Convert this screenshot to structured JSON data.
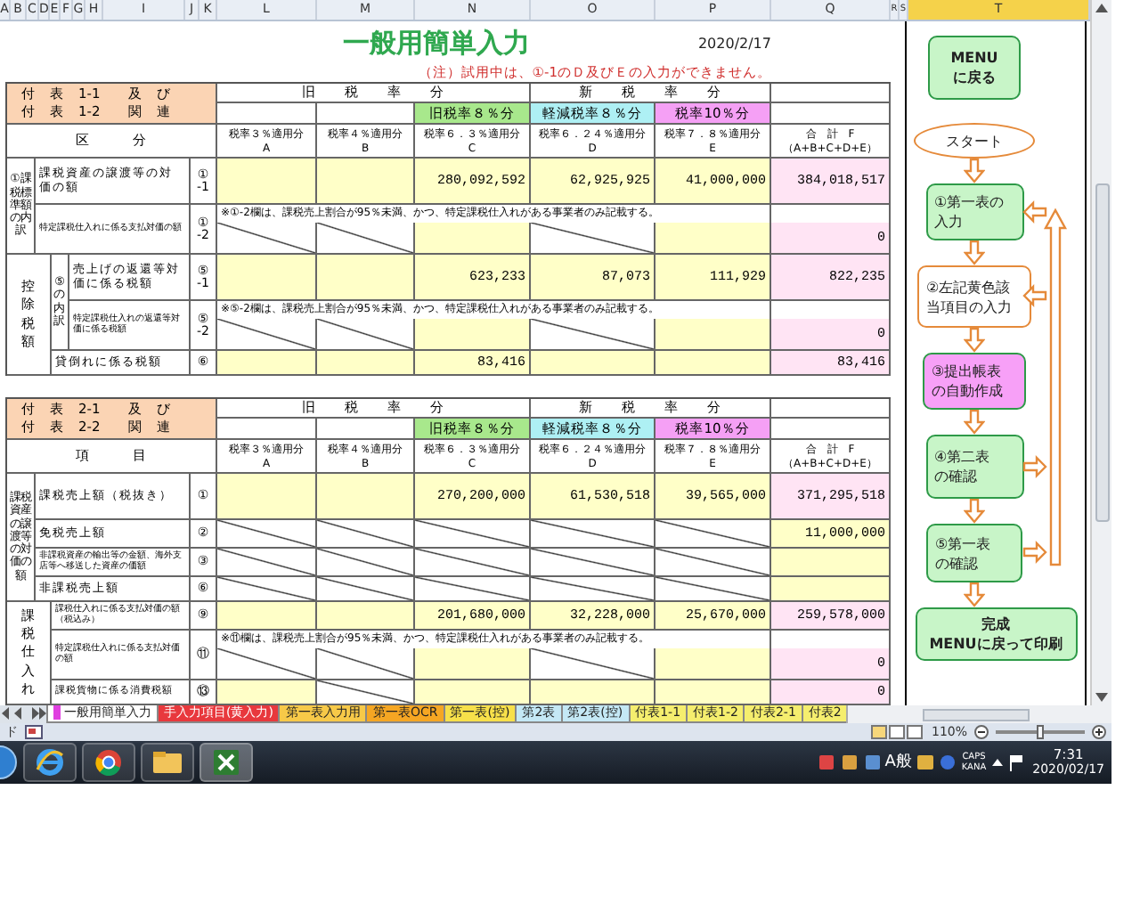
{
  "column_letters": [
    {
      "label": "A",
      "selected": false
    },
    {
      "label": "B",
      "selected": false
    },
    {
      "label": "C",
      "selected": false
    },
    {
      "label": "D",
      "selected": false
    },
    {
      "label": "E",
      "selected": false
    },
    {
      "label": "F",
      "selected": false
    },
    {
      "label": "G",
      "selected": false
    },
    {
      "label": "H",
      "selected": false
    },
    {
      "label": "I",
      "selected": false
    },
    {
      "label": "J",
      "selected": false
    },
    {
      "label": "K",
      "selected": false
    },
    {
      "label": "L",
      "selected": false
    },
    {
      "label": "M",
      "selected": false
    },
    {
      "label": "N",
      "selected": false
    },
    {
      "label": "O",
      "selected": false
    },
    {
      "label": "P",
      "selected": false
    },
    {
      "label": "Q",
      "selected": false
    },
    {
      "label": "R",
      "selected": false
    },
    {
      "label": "S",
      "selected": false
    },
    {
      "label": "T",
      "selected": true
    }
  ],
  "title": "一般用簡単入力",
  "date": "2020/2/17",
  "notice": "（注）試用中は、①-1のＤ及びＥの入力ができません。",
  "tables": [
    {
      "heading_lines": [
        "付　表　1-1　　及　び",
        "付　表　1-2　　関　連"
      ],
      "row_head": "区　　　分",
      "old_rate": "旧　　税　　率　　分",
      "new_rate": "新　　税　　率　　分",
      "rate_tags": [
        {
          "label": "旧税率８％分",
          "color": "#a8e88c"
        },
        {
          "label": "軽減税率８％分",
          "color": "#aef0f4"
        },
        {
          "label": "税率10％分",
          "color": "#f5a0f5"
        }
      ],
      "column_heads": [
        {
          "label": "税率３％適用分",
          "letter": "A"
        },
        {
          "label": "税率４％適用分",
          "letter": "B"
        },
        {
          "label": "税率６．３％適用分",
          "letter": "C"
        },
        {
          "label": "税率６．２４％適用分",
          "letter": "D"
        },
        {
          "label": "税率７．８％適用分",
          "letter": "E"
        }
      ],
      "total_head": {
        "label": "合　計　F",
        "formula": "（A+B+C+D+E）"
      },
      "groups": [
        {
          "label": "①課税標準額の内訳",
          "kind": "double",
          "parts": [
            {
              "rows": [
                {
                  "no": "①-1",
                  "label": "課税資産の譲渡等の対価の額",
                  "kind": "tall",
                  "cells": [
                    {
                      "kind": "input"
                    },
                    {
                      "kind": "input"
                    },
                    {
                      "kind": "input",
                      "value": "280,092,592"
                    },
                    {
                      "kind": "input",
                      "value": "62,925,925"
                    },
                    {
                      "kind": "input",
                      "value": "41,000,000"
                    },
                    {
                      "kind": "total",
                      "value": "384,018,517"
                    }
                  ]
                },
                {
                  "no": "①-2",
                  "label": "特定課税仕入れに係る支払対価の額",
                  "kind": "note",
                  "note": "※①-2欄は、課税売上割合が95％未満、かつ、特定課税仕入れがある事業者のみ記載する。",
                  "cells": [
                    {
                      "kind": "struck"
                    },
                    {
                      "kind": "struck"
                    },
                    {
                      "kind": "input"
                    },
                    {
                      "kind": "struck"
                    },
                    {
                      "kind": "input"
                    },
                    {
                      "kind": "total",
                      "value": "0"
                    }
                  ]
                }
              ]
            }
          ]
        },
        {
          "label": "控除税額",
          "kind": "single",
          "parts": [
            {
              "label": "⑤の内訳",
              "rows": [
                {
                  "no": "⑤-1",
                  "label": "売上げの返還等対価に係る税額",
                  "kind": "tall",
                  "cells": [
                    {
                      "kind": "input"
                    },
                    {
                      "kind": "input"
                    },
                    {
                      "kind": "input",
                      "value": "623,233"
                    },
                    {
                      "kind": "input",
                      "value": "87,073"
                    },
                    {
                      "kind": "input",
                      "value": "111,929"
                    },
                    {
                      "kind": "total",
                      "value": "822,235"
                    }
                  ]
                },
                {
                  "no": "⑤-2",
                  "label": "特定課税仕入れの返還等対価に係る税額",
                  "kind": "note",
                  "note": "※⑤-2欄は、課税売上割合が95％未満、かつ、特定課税仕入れがある事業者のみ記載する。",
                  "cells": [
                    {
                      "kind": "struck"
                    },
                    {
                      "kind": "struck"
                    },
                    {
                      "kind": "input"
                    },
                    {
                      "kind": "struck"
                    },
                    {
                      "kind": "input"
                    },
                    {
                      "kind": "total",
                      "value": "0"
                    }
                  ]
                }
              ]
            },
            {
              "rows": [
                {
                  "no": "⑥",
                  "label": "貸倒れに係る税額",
                  "kind": "short",
                  "cells": [
                    {
                      "kind": "input"
                    },
                    {
                      "kind": "input"
                    },
                    {
                      "kind": "input",
                      "value": "83,416"
                    },
                    {
                      "kind": "input"
                    },
                    {
                      "kind": "input"
                    },
                    {
                      "kind": "total",
                      "value": "83,416"
                    }
                  ]
                }
              ]
            }
          ]
        }
      ]
    },
    {
      "heading_lines": [
        "付　表　2-1　　及　び",
        "付　表　2-2　　関　連"
      ],
      "row_head": "項　　　目",
      "old_rate": "旧　　税　　率　　分",
      "new_rate": "新　　税　　率　　分",
      "rate_tags": [
        {
          "label": "旧税率８％分",
          "color": "#a8e88c"
        },
        {
          "label": "軽減税率８％分",
          "color": "#aef0f4"
        },
        {
          "label": "税率10％分",
          "color": "#f5a0f5"
        }
      ],
      "column_heads": [
        {
          "label": "税率３％適用分",
          "letter": "A"
        },
        {
          "label": "税率４％適用分",
          "letter": "B"
        },
        {
          "label": "税率６．３％適用分",
          "letter": "C"
        },
        {
          "label": "税率６．２４％適用分",
          "letter": "D"
        },
        {
          "label": "税率７．８％適用分",
          "letter": "E"
        }
      ],
      "total_head": {
        "label": "合　計　F",
        "formula": "（A+B+C+D+E）"
      },
      "groups": [
        {
          "label": "課税資産の譲渡等の対価の額",
          "kind": "double",
          "parts": [
            {
              "rows": [
                {
                  "no": "①",
                  "label": "課税売上額（税抜き）",
                  "kind": "tall",
                  "cells": [
                    {
                      "kind": "input"
                    },
                    {
                      "kind": "input"
                    },
                    {
                      "kind": "input",
                      "value": "270,200,000"
                    },
                    {
                      "kind": "input",
                      "value": "61,530,518"
                    },
                    {
                      "kind": "input",
                      "value": "39,565,000"
                    },
                    {
                      "kind": "total",
                      "value": "371,295,518"
                    }
                  ]
                },
                {
                  "no": "②",
                  "label": "免税売上額",
                  "kind": "medium",
                  "cells": [
                    {
                      "kind": "struck"
                    },
                    {
                      "kind": "struck"
                    },
                    {
                      "kind": "struck"
                    },
                    {
                      "kind": "struck"
                    },
                    {
                      "kind": "struck"
                    },
                    {
                      "kind": "input",
                      "value": "11,000,000"
                    }
                  ]
                },
                {
                  "no": "③",
                  "label": "非課税資産の輸出等の金額、海外支店等へ移送した資産の価額",
                  "kind": "medium",
                  "cells": [
                    {
                      "kind": "struck"
                    },
                    {
                      "kind": "struck"
                    },
                    {
                      "kind": "struck"
                    },
                    {
                      "kind": "struck"
                    },
                    {
                      "kind": "struck"
                    },
                    {
                      "kind": "input"
                    }
                  ]
                },
                {
                  "no": "⑥",
                  "label": "非課税売上額",
                  "kind": "short",
                  "cells": [
                    {
                      "kind": "struck"
                    },
                    {
                      "kind": "struck"
                    },
                    {
                      "kind": "struck"
                    },
                    {
                      "kind": "struck"
                    },
                    {
                      "kind": "struck"
                    },
                    {
                      "kind": "input"
                    }
                  ]
                }
              ]
            }
          ]
        },
        {
          "label": "課税仕入れ",
          "kind": "single",
          "parts": [
            {
              "rows": [
                {
                  "no": "⑨",
                  "label": "課税仕入れに係る支払対価の額（税込み）",
                  "kind": "medium",
                  "cells": [
                    {
                      "kind": "input"
                    },
                    {
                      "kind": "input"
                    },
                    {
                      "kind": "input",
                      "value": "201,680,000"
                    },
                    {
                      "kind": "input",
                      "value": "32,228,000"
                    },
                    {
                      "kind": "input",
                      "value": "25,670,000"
                    },
                    {
                      "kind": "total",
                      "value": "259,578,000"
                    }
                  ]
                },
                {
                  "no": "⑪",
                  "label": "特定課税仕入れに係る支払対価の額",
                  "kind": "note",
                  "note": "※⑪欄は、課税売上割合が95％未満、かつ、特定課税仕入れがある事業者のみ記載する。",
                  "cells": [
                    {
                      "kind": "struck"
                    },
                    {
                      "kind": "struck"
                    },
                    {
                      "kind": "input"
                    },
                    {
                      "kind": "struck"
                    },
                    {
                      "kind": "input"
                    },
                    {
                      "kind": "total",
                      "value": "0"
                    }
                  ]
                },
                {
                  "no": "⑬",
                  "label": "課税貨物に係る消費税額",
                  "kind": "short",
                  "cells": [
                    {
                      "kind": "input"
                    },
                    {
                      "kind": "struck"
                    },
                    {
                      "kind": "input"
                    },
                    {
                      "kind": "input"
                    },
                    {
                      "kind": "input"
                    },
                    {
                      "kind": "total",
                      "value": "0"
                    }
                  ]
                }
              ]
            }
          ]
        }
      ]
    }
  ],
  "flowchart": {
    "nodes": [
      {
        "kind": "button",
        "lines": [
          "MENU",
          "に戻る"
        ],
        "color": "#c8f5c8"
      },
      {
        "kind": "terminal",
        "lines": [
          "スタート"
        ],
        "color": "#ffffff"
      },
      {
        "kind": "process",
        "lines": [
          "①第一表の",
          "入力"
        ],
        "color": "#c8f5c8"
      },
      {
        "kind": "input-step",
        "lines": [
          "②左記黄色該",
          "当項目の入力"
        ],
        "color": "#ffffff"
      },
      {
        "kind": "process",
        "lines": [
          "③提出帳表",
          "の自動作成"
        ],
        "color": "#f7a0f7"
      },
      {
        "kind": "process",
        "lines": [
          "④第二表",
          "の確認"
        ],
        "color": "#c8f5c8"
      },
      {
        "kind": "process",
        "lines": [
          "⑤第一表",
          "の確認"
        ],
        "color": "#c8f5c8"
      },
      {
        "kind": "button",
        "lines": [
          "完成",
          "MENUに戻って印刷"
        ],
        "color": "#c8f5c8"
      }
    ]
  },
  "sheet_tabs": [
    {
      "label": "一般用簡単入力",
      "selected": true,
      "color": "#e040e0"
    },
    {
      "label": "手入力項目(黄入力)",
      "selected": false,
      "color": "#e8383d"
    },
    {
      "label": "第一表入力用",
      "selected": false,
      "color": "#f7c948"
    },
    {
      "label": "第一表OCR",
      "selected": false,
      "color": "#f5a623"
    },
    {
      "label": "第一表(控)",
      "selected": false,
      "color": "#f7e04a"
    },
    {
      "label": "第2表",
      "selected": false,
      "color": "#c4e8f5"
    },
    {
      "label": "第2表(控)",
      "selected": false,
      "color": "#c4e8f5"
    },
    {
      "label": "付表1-1",
      "selected": false,
      "color": "#f5ee6e"
    },
    {
      "label": "付表1-2",
      "selected": false,
      "color": "#f5ee6e"
    },
    {
      "label": "付表2-1",
      "selected": false,
      "color": "#f5ee6e"
    },
    {
      "label": "付表2",
      "selected": false,
      "color": "#f5ee6e"
    }
  ],
  "status_bar": {
    "mode_text": "ド",
    "zoom": "110%",
    "zoom_slider": {
      "level": 0.5
    }
  },
  "taskbar": {
    "ime": "A般",
    "caps": "CAPS",
    "kana": "KANA",
    "time": "7:31",
    "date": "2020/02/17"
  }
}
